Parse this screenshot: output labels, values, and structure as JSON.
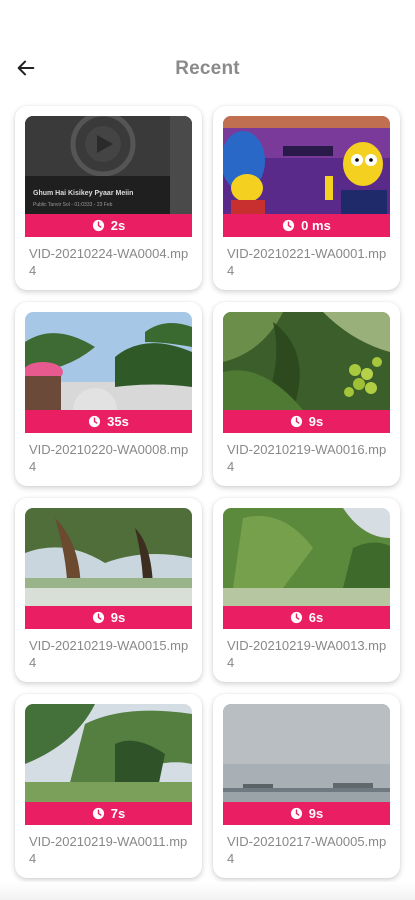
{
  "header": {
    "title": "Recent"
  },
  "videos": [
    {
      "duration": "2s",
      "name": "VID-20210224-WA0004.mp4",
      "thumb_title": "Ghum Hai Kisikey Pyaar Meiin",
      "thumb_sub": "Public Tanvir Sol - 01:0333 - 23 Feb"
    },
    {
      "duration": "0 ms",
      "name": "VID-20210221-WA0001.mp4"
    },
    {
      "duration": "35s",
      "name": "VID-20210220-WA0008.mp4"
    },
    {
      "duration": "9s",
      "name": "VID-20210219-WA0016.mp4"
    },
    {
      "duration": "9s",
      "name": "VID-20210219-WA0015.mp4"
    },
    {
      "duration": "6s",
      "name": "VID-20210219-WA0013.mp4"
    },
    {
      "duration": "7s",
      "name": "VID-20210219-WA0011.mp4"
    },
    {
      "duration": "9s",
      "name": "VID-20210217-WA0005.mp4"
    }
  ],
  "colors": {
    "accent": "#ea1f63",
    "title": "#8a8a8a",
    "filename": "#888888"
  },
  "icons": {
    "back": "arrow-left-icon",
    "duration": "clock-icon"
  }
}
